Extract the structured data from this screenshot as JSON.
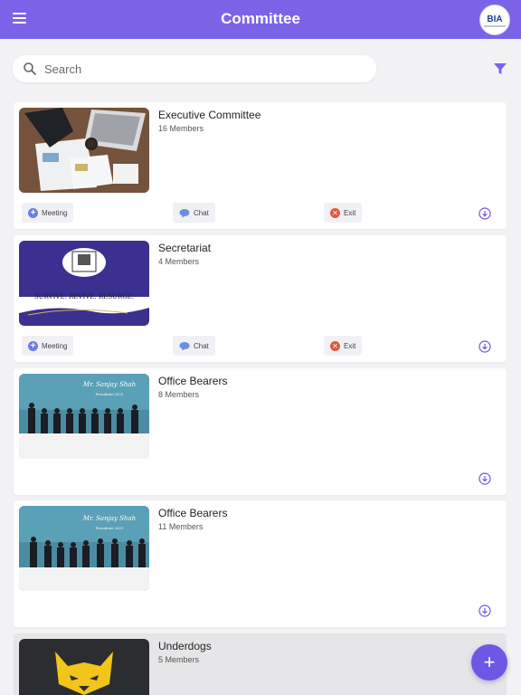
{
  "header": {
    "title": "Committee",
    "logo_text": "BIA"
  },
  "search": {
    "placeholder": "Search",
    "value": ""
  },
  "actions": {
    "meeting": "Meeting",
    "chat": "Chat",
    "exit": "Exit"
  },
  "committees": [
    {
      "name": "Executive Committee",
      "members": "16 Members"
    },
    {
      "name": "Secretariat",
      "members": "4 Members",
      "banner_text": "SURVIVE. REVIVE. RESURGE."
    },
    {
      "name": "Office Bearers",
      "members": "8 Members",
      "banner_text": "Mr. Sanjay Shah",
      "banner_sub": "President 2021"
    },
    {
      "name": "Office Bearers",
      "members": "11 Members",
      "banner_text": "Mr. Sanjay Shah",
      "banner_sub": "President 2021"
    },
    {
      "name": "Underdogs",
      "members": "5 Members"
    }
  ],
  "colors": {
    "header": "#7b63e8",
    "accent": "#6c58e3",
    "meeting_icon": "#6b7fe0",
    "exit_icon": "#e0583c"
  },
  "icons": [
    "menu-icon",
    "search-icon",
    "filter-icon",
    "plus-circle-icon",
    "chat-bubble-icon",
    "close-circle-icon",
    "download-circle-icon",
    "plus-icon"
  ]
}
